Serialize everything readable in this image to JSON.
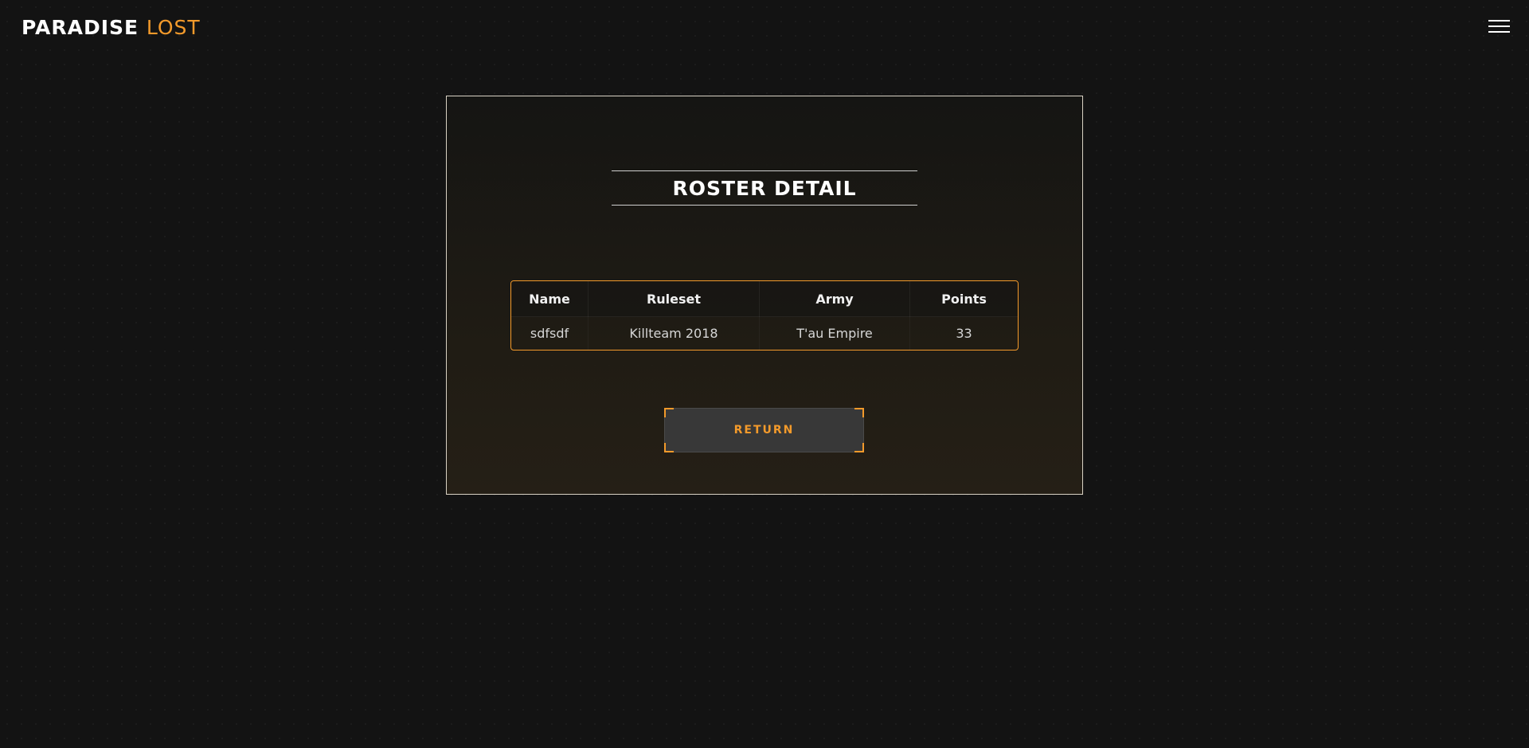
{
  "header": {
    "brand_first": "PARADISE",
    "brand_second": "LOST",
    "menu_icon": "hamburger-menu-icon"
  },
  "roster": {
    "title": "ROSTER DETAIL",
    "columns": [
      "Name",
      "Ruleset",
      "Army",
      "Points"
    ],
    "rows": [
      [
        "sdfsdf",
        "Killteam 2018",
        "T'au Empire",
        "33"
      ]
    ],
    "return_label": "RETURN"
  },
  "colors": {
    "accent": "#f39a2b",
    "background": "#131313",
    "button_bg": "#383838"
  }
}
